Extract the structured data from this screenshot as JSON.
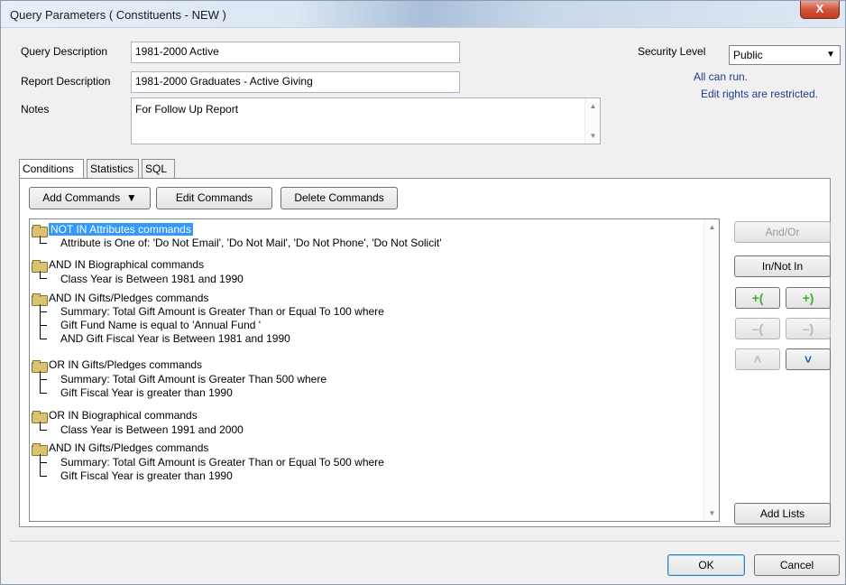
{
  "window": {
    "title": "Query Parameters ( Constituents - NEW )",
    "close_label": "X"
  },
  "form": {
    "query_description_label": "Query Description",
    "query_description_value": "1981-2000 Active",
    "report_description_label": "Report Description",
    "report_description_value": "1981-2000 Graduates - Active Giving",
    "notes_label": "Notes",
    "notes_value": "For Follow Up Report",
    "security_level_label": "Security Level",
    "security_level_value": "Public",
    "security_note_1": "All can run.",
    "security_note_2": "Edit rights are restricted."
  },
  "tabs": [
    {
      "label": "Conditions"
    },
    {
      "label": "Statistics"
    },
    {
      "label": "SQL"
    }
  ],
  "toolbar": {
    "add_commands": "Add Commands",
    "edit_commands": "Edit Commands",
    "delete_commands": "Delete Commands"
  },
  "tree": {
    "groups": [
      {
        "label": "NOT IN Attributes commands",
        "items": [
          "Attribute is One of: 'Do Not Email', 'Do Not Mail', 'Do Not Phone', 'Do Not Solicit'"
        ]
      },
      {
        "label": "AND IN Biographical commands",
        "items": [
          "Class Year is Between 1981 and 1990"
        ]
      },
      {
        "label": "AND IN Gifts/Pledges commands",
        "items": [
          "Summary: Total Gift Amount is Greater Than or Equal To 100 where",
          "Gift Fund Name is equal to 'Annual Fund '",
          "AND Gift Fiscal Year is Between 1981 and 1990"
        ]
      },
      {
        "label": "OR IN Gifts/Pledges commands",
        "items": [
          "Summary: Total Gift Amount is Greater Than 500 where",
          "Gift Fiscal Year is greater than 1990"
        ]
      },
      {
        "label": "OR IN Biographical commands",
        "items": [
          "Class Year is Between 1991 and 2000"
        ]
      },
      {
        "label": "AND IN Gifts/Pledges commands",
        "items": [
          "Summary: Total Gift Amount is Greater Than or Equal To 500 where",
          "Gift Fiscal Year is greater than 1990"
        ]
      }
    ]
  },
  "side_buttons": {
    "and_or": "And/Or",
    "in_not_in": "In/Not In",
    "add_lists": "Add Lists",
    "add_open_paren": "+(",
    "add_close_paren": "+)",
    "remove_open_paren": "–(",
    "remove_close_paren": "–)",
    "move_up": "˄",
    "move_down": "˅"
  },
  "footer": {
    "ok": "OK",
    "cancel": "Cancel"
  }
}
